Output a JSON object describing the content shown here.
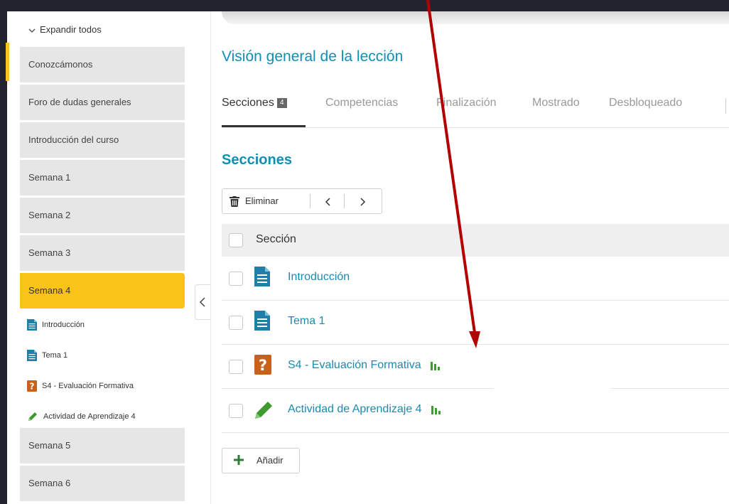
{
  "sidebar": {
    "expand_label": "Expandir todos",
    "items": [
      {
        "label": "Conozcámonos"
      },
      {
        "label": "Foro de dudas generales"
      },
      {
        "label": "Introducción del curso"
      },
      {
        "label": "Semana 1"
      },
      {
        "label": "Semana 2"
      },
      {
        "label": "Semana 3"
      },
      {
        "label": "Semana 4",
        "active": true
      },
      {
        "label": "Semana 5"
      },
      {
        "label": "Semana 6"
      }
    ],
    "subitems": [
      {
        "label": "Introducción",
        "icon": "document-icon"
      },
      {
        "label": "Tema 1",
        "icon": "document-icon"
      },
      {
        "label": "S4 - Evaluación Formativa",
        "icon": "quiz-icon"
      },
      {
        "label": "Actividad de Aprendizaje 4",
        "icon": "pencil-icon"
      }
    ]
  },
  "main": {
    "title": "Visión general de la lección",
    "tabs": [
      {
        "label": "Secciones",
        "count": "4",
        "active": true
      },
      {
        "label": "Competencias"
      },
      {
        "label": "Finalización"
      },
      {
        "label": "Mostrado"
      },
      {
        "label": "Desbloqueado"
      }
    ],
    "section_heading": "Secciones",
    "toolbar": {
      "delete_label": "Eliminar"
    },
    "table": {
      "header": "Sección",
      "rows": [
        {
          "label": "Introducción",
          "icon": "document-icon"
        },
        {
          "label": "Tema 1",
          "icon": "document-icon"
        },
        {
          "label": "S4 - Evaluación Formativa",
          "icon": "quiz-icon",
          "stats": true
        },
        {
          "label": "Actividad de Aprendizaje 4",
          "icon": "pencil-icon",
          "stats": true
        }
      ]
    },
    "add_label": "Añadir"
  },
  "colors": {
    "accent": "#0e8fb6",
    "active_item": "#f9c317",
    "annotation_arrow": "#b30000",
    "stats_green": "#3b9e2a"
  }
}
